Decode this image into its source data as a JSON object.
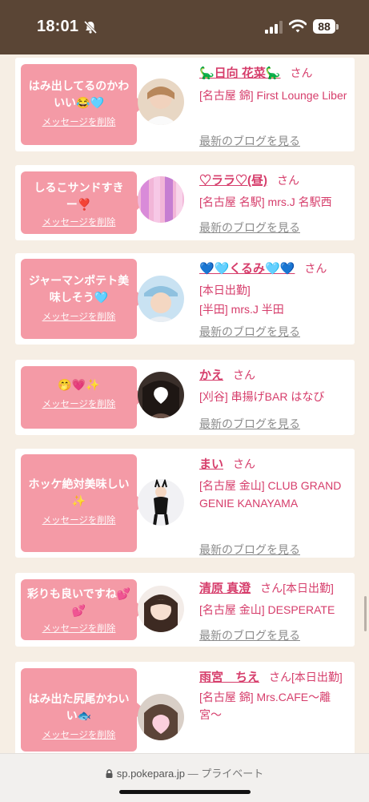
{
  "status_bar": {
    "time": "18:01",
    "battery": "88",
    "icons": [
      "bell-slash-icon",
      "cellular-signal-icon",
      "wifi-icon",
      "battery-icon"
    ]
  },
  "colors": {
    "status_bar_bg": "#5a4535",
    "page_bg": "#f6eee4",
    "bubble_bg": "#f49aa6",
    "accent_text": "#d63d6b",
    "muted_link": "#8b8b8b"
  },
  "feed": {
    "delete_label": "メッセージを削除",
    "san_label": "さん",
    "blog_label": "最新のブログを見る",
    "cards": [
      {
        "message": "はみ出してるのかわいい😂🩵",
        "name": "🦕日向 花菜🦕",
        "san_extra": "",
        "shop": "[名古屋 錦] First Lounge Liber",
        "shop2": ""
      },
      {
        "message": "しるこサンドすきー❣️",
        "name": "♡ララ♡(昼)",
        "san_extra": "",
        "shop": "[名古屋 名駅] mrs.J 名駅西",
        "shop2": ""
      },
      {
        "message": "ジャーマンポテト美味しそう🩵",
        "name": "💙🩵くるみ🩵💙",
        "san_extra": "",
        "shop": "[本日出勤]",
        "shop2": "[半田] mrs.J 半田"
      },
      {
        "message": "🤭💗✨",
        "name": "かえ",
        "san_extra": "",
        "shop": "[刈谷] 串揚げBAR はなび",
        "shop2": ""
      },
      {
        "message": "ホッケ絶対美味しい✨",
        "name": "まい",
        "san_extra": "",
        "shop": "[名古屋 金山] CLUB GRAND GENIE KANAYAMA",
        "shop2": ""
      },
      {
        "message": "彩りも良いですね💕💕",
        "name": "清原 真澄",
        "san_extra": "[本日出勤]",
        "shop": "[名古屋 金山] DESPERATE",
        "shop2": ""
      },
      {
        "message": "はみ出た尻尾かわいい🐟",
        "name": "雨宮　ちえ",
        "san_extra": "[本日出勤]",
        "shop": "[名古屋 錦] Mrs.CAFE〜離宮〜",
        "shop2": ""
      }
    ]
  },
  "browser": {
    "domain": "sp.pokepara.jp",
    "privacy": "— プライベート"
  }
}
